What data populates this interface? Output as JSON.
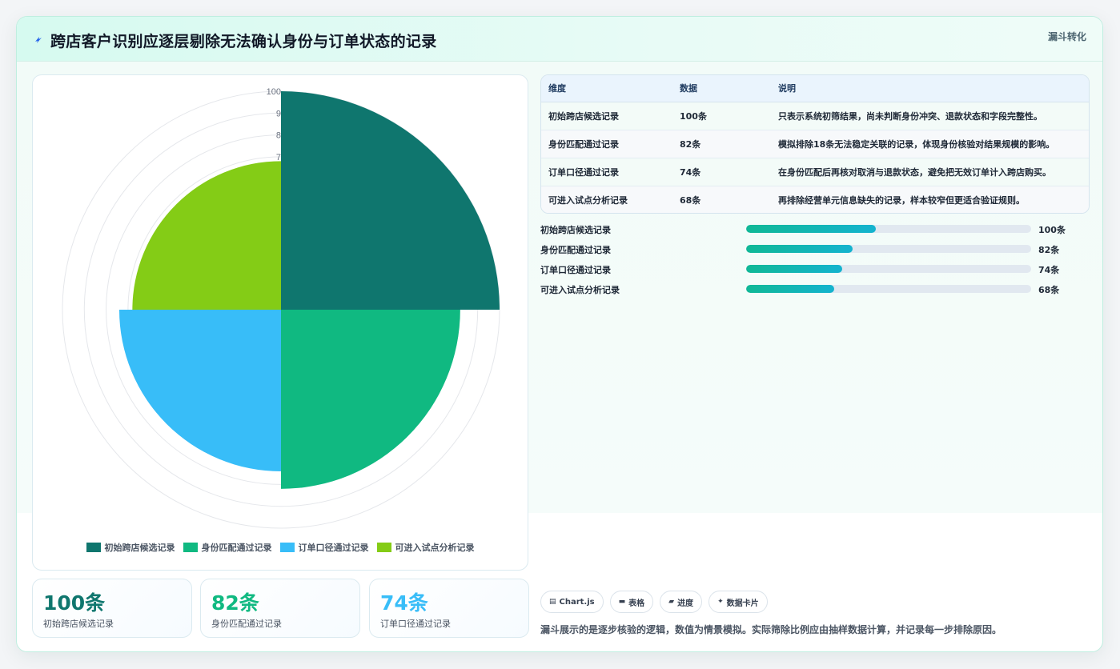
{
  "header": {
    "title": "跨店客户识别应逐层剔除无法确认身份与订单状态的记录",
    "badge": "漏斗转化",
    "icon": "lightning-icon"
  },
  "chart_data": {
    "type": "polar-area",
    "categories": [
      "初始跨店候选记录",
      "身份匹配通过记录",
      "订单口径通过记录",
      "可进入试点分析记录"
    ],
    "values": [
      100,
      82,
      74,
      68
    ],
    "colors": [
      "#0f766e",
      "#10b981",
      "#38bdf8",
      "#84cc16"
    ],
    "rlim": [
      0,
      100
    ],
    "tick_labels": [
      "100",
      "9",
      "8",
      "7"
    ],
    "grid": true,
    "legend": "bottom"
  },
  "stats": [
    {
      "value": "100条",
      "label": "初始跨店候选记录",
      "color": "#0f766e"
    },
    {
      "value": "82条",
      "label": "身份匹配通过记录",
      "color": "#10b981"
    },
    {
      "value": "74条",
      "label": "订单口径通过记录",
      "color": "#38bdf8"
    }
  ],
  "table": {
    "headers": [
      "维度",
      "数据",
      "说明"
    ],
    "rows": [
      [
        "初始跨店候选记录",
        "100条",
        "只表示系统初筛结果，尚未判断身份冲突、退款状态和字段完整性。"
      ],
      [
        "身份匹配通过记录",
        "82条",
        "模拟排除18条无法稳定关联的记录，体现身份核验对结果规模的影响。"
      ],
      [
        "订单口径通过记录",
        "74条",
        "在身份匹配后再核对取消与退款状态，避免把无效订单计入跨店购买。"
      ],
      [
        "可进入试点分析记录",
        "68条",
        "再排除经营单元信息缺失的记录，样本较窄但更适合验证规则。"
      ]
    ]
  },
  "progress": [
    {
      "label": "初始跨店候选记录",
      "fraction": 0.455,
      "value": "100条"
    },
    {
      "label": "身份匹配通过记录",
      "fraction": 0.373,
      "value": "82条"
    },
    {
      "label": "订单口径通过记录",
      "fraction": 0.337,
      "value": "74条"
    },
    {
      "label": "可进入试点分析记录",
      "fraction": 0.309,
      "value": "68条"
    }
  ],
  "chips": [
    {
      "icon": "chart-icon",
      "glyph": "▤",
      "label": "Chart.js"
    },
    {
      "icon": "table-icon",
      "glyph": "▬",
      "label": "表格"
    },
    {
      "icon": "progress-icon",
      "glyph": "▰",
      "label": "进度"
    },
    {
      "icon": "sparkle-icon",
      "glyph": "✦",
      "label": "数据卡片"
    }
  ],
  "footnote": "漏斗展示的是逐步核验的逻辑，数值为情景模拟。实际筛除比例应由抽样数据计算，并记录每一步排除原因。"
}
